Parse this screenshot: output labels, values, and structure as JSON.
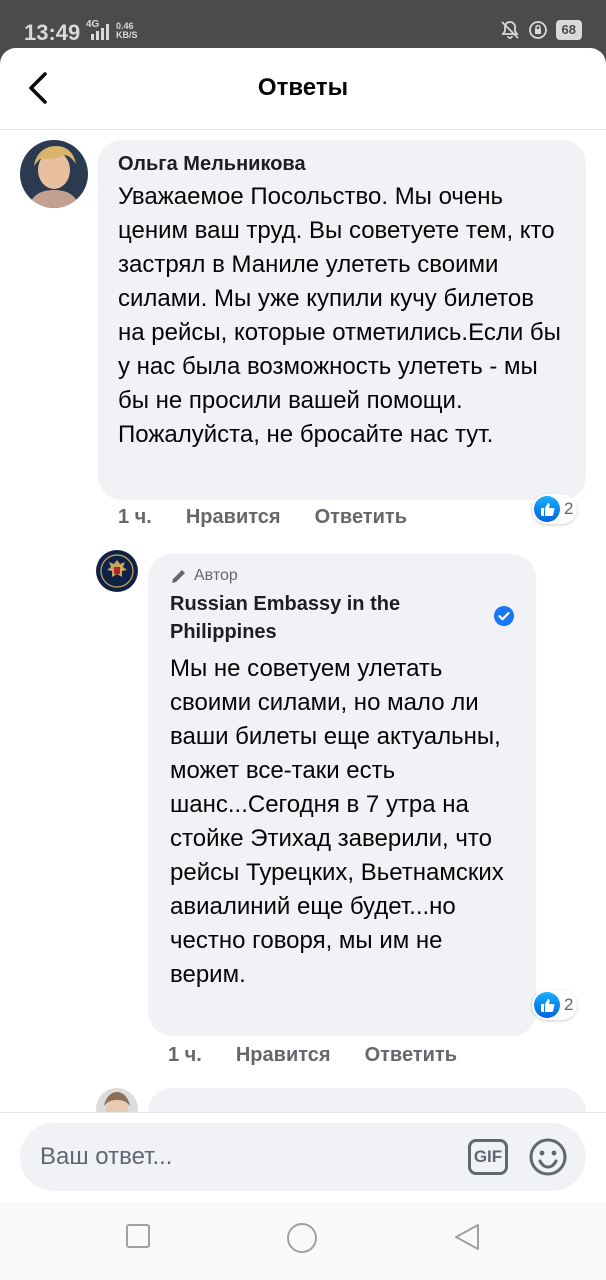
{
  "status_bar": {
    "time": "13:49",
    "network": "4G",
    "speed_value": "0.46",
    "speed_unit": "KB/S",
    "battery": "68"
  },
  "header": {
    "title": "Ответы"
  },
  "comments": [
    {
      "author": "Ольга Мельникова",
      "text": "Уважаемое Посольство. Мы очень ценим ваш труд. Вы советуете тем, кто застрял в Маниле улететь своими силами. Мы уже купили кучу билетов на рейсы, которые отметились.Если бы у нас была возможность улететь - мы бы не просили вашей помощи. Пожалуйста, не бросайте нас тут.",
      "time": "1 ч.",
      "like_label": "Нравится",
      "reply_label": "Ответить",
      "reaction_count": "2"
    },
    {
      "badge": "Автор",
      "author": "Russian Embassy in the Philippines",
      "text": "Мы не советуем улетать своими силами, но мало ли ваши билеты еще актуальны, может все-таки есть шанс...Сегодня в 7 утра на стойке Этихад заверили, что рейсы Турецких, Вьетнамских авиалиний еще будет...но честно говоря, мы им не верим.",
      "time": "1 ч.",
      "like_label": "Нравится",
      "reply_label": "Ответить",
      "reaction_count": "2"
    }
  ],
  "composer": {
    "placeholder": "Ваш ответ...",
    "gif_label": "GIF"
  },
  "colors": {
    "bubble": "#f0f2f5",
    "like_blue": "#1877f2",
    "verified_blue": "#1877f2",
    "meta_grey": "#65676b"
  }
}
